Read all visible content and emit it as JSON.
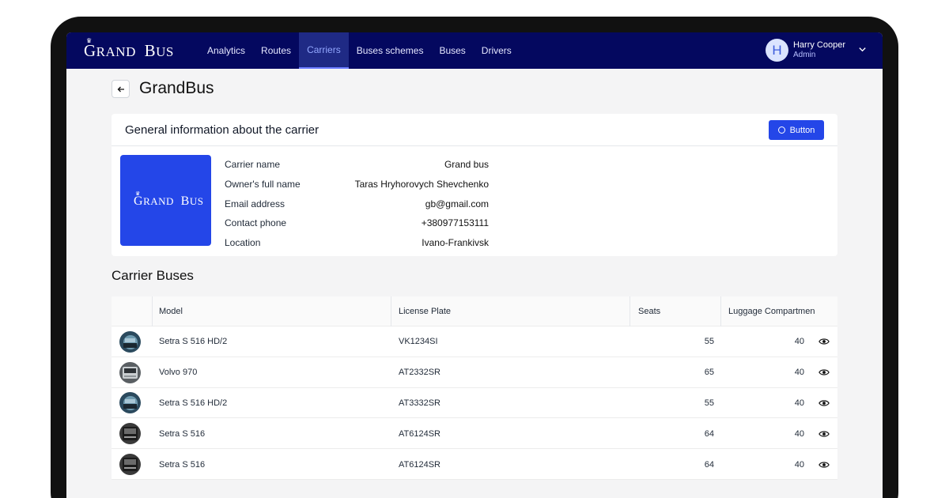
{
  "app": {
    "logo_text_first": "G",
    "logo_text_rest": "RAND",
    "logo_text_second_first": "B",
    "logo_text_second_rest": "US"
  },
  "nav": {
    "items": [
      {
        "label": "Analytics"
      },
      {
        "label": "Routes"
      },
      {
        "label": "Carriers"
      },
      {
        "label": "Buses schemes"
      },
      {
        "label": "Buses"
      },
      {
        "label": "Drivers"
      }
    ],
    "active": "Carriers"
  },
  "user": {
    "initial": "H",
    "name": "Harry Cooper",
    "role": "Admin"
  },
  "page": {
    "title": "GrandBus"
  },
  "carrier_card": {
    "title": "General information about the carrier",
    "button_label": "Button",
    "fields": [
      {
        "label": "Carrier name",
        "value": "Grand bus"
      },
      {
        "label": "Owner's full name",
        "value": "Taras Hryhorovych Shevchenko"
      },
      {
        "label": "Email address",
        "value": "gb@gmail.com"
      },
      {
        "label": "Contact phone",
        "value": "+380977153111"
      },
      {
        "label": "Location",
        "value": "Ivano-Frankivsk"
      }
    ]
  },
  "buses": {
    "title": "Carrier Buses",
    "columns": {
      "model": "Model",
      "plate": "License Plate",
      "seats": "Seats",
      "luggage": "Luggage Compartmen"
    },
    "rows": [
      {
        "model": "Setra S 516 HD/2",
        "plate": "VK1234SI",
        "seats": "55",
        "luggage": "40"
      },
      {
        "model": "Volvo 970",
        "plate": "AT2332SR",
        "seats": "65",
        "luggage": "40"
      },
      {
        "model": "Setra S 516 HD/2",
        "plate": "AT3332SR",
        "seats": "55",
        "luggage": "40"
      },
      {
        "model": "Setra S 516",
        "plate": "AT6124SR",
        "seats": "64",
        "luggage": "40"
      },
      {
        "model": "Setra S 516",
        "plate": "AT6124SR",
        "seats": "64",
        "luggage": "40"
      }
    ]
  },
  "colors": {
    "nav_bg": "#04085f",
    "accent": "#2446e8"
  }
}
